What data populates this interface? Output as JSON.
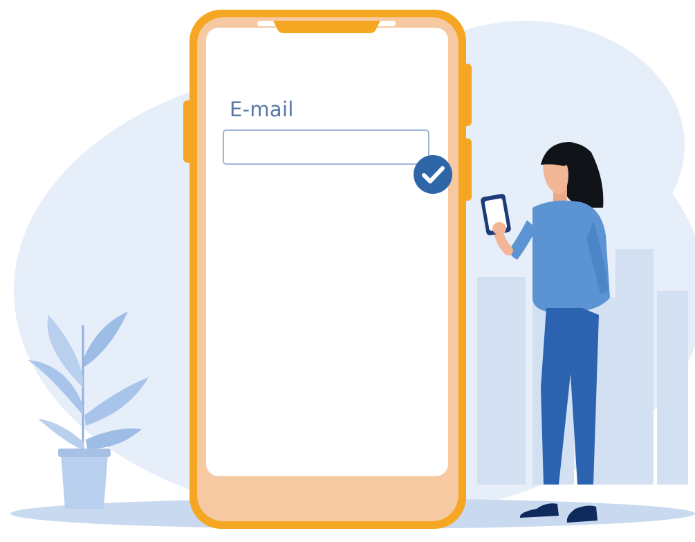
{
  "form": {
    "email_label": "E-mail",
    "email_value": ""
  },
  "icons": {
    "validation": "checkmark-circle-icon"
  },
  "colors": {
    "phone_frame": "#f5a623",
    "phone_body": "#f7c9a3",
    "screen": "#ffffff",
    "check_badge": "#2f66a8",
    "label_text": "#5878a8",
    "backdrop": "#e4edf8",
    "person_shirt": "#5b93d3",
    "person_pants": "#2b63b0"
  }
}
